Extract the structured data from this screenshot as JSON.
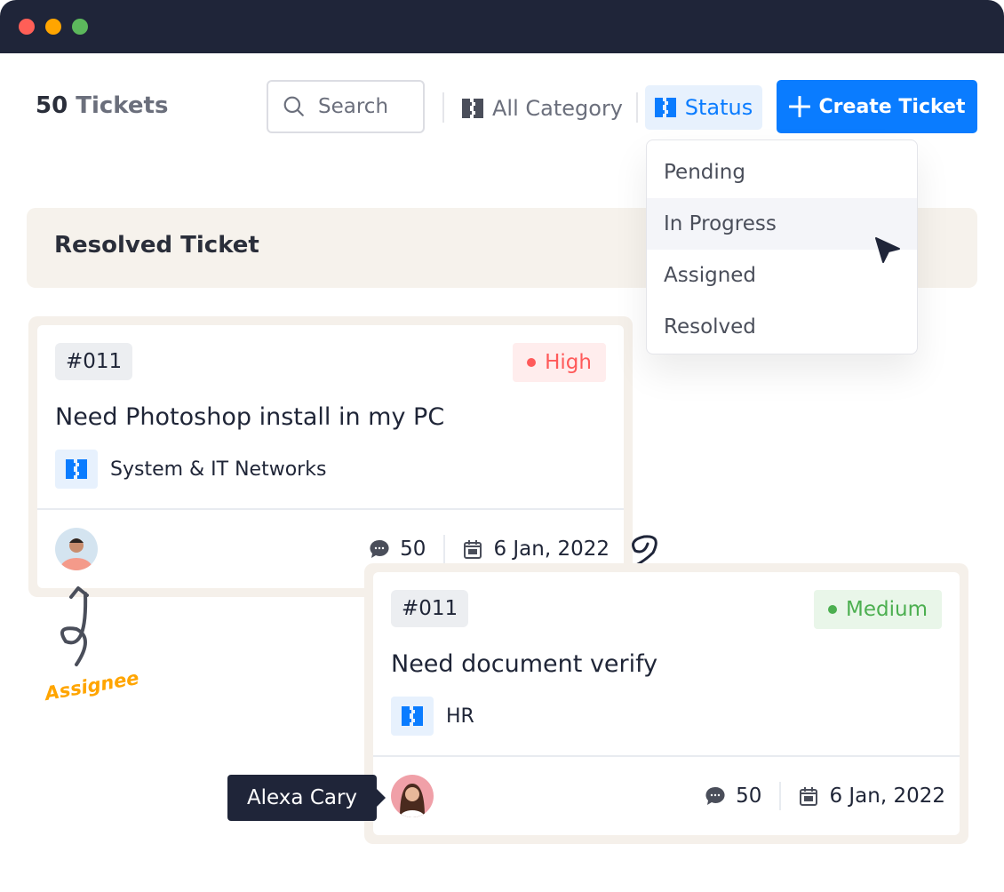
{
  "window": {
    "dots": [
      "#ff5f57",
      "#ffa500",
      "#5cb85c"
    ]
  },
  "header": {
    "count": "50",
    "count_label": "Tickets",
    "search_placeholder": "Search",
    "category_filter": "All Category",
    "status_filter": "Status",
    "create_button": "Create Ticket"
  },
  "status_dropdown": {
    "options": [
      "Pending",
      "In Progress",
      "Assigned",
      "Resolved"
    ],
    "highlighted": "In Progress"
  },
  "section_title": "Resolved Ticket",
  "tickets": [
    {
      "id": "#011",
      "priority": "High",
      "priority_color": "#ff5a5a",
      "priority_bg": "#ffeded",
      "title": "Need Photoshop install in my PC",
      "category": "System & IT Networks",
      "comments": "50",
      "date": "6 Jan, 2022"
    },
    {
      "id": "#011",
      "priority": "Medium",
      "priority_color": "#4caf50",
      "priority_bg": "#e9f6e9",
      "title": "Need document verify",
      "category": "HR",
      "comments": "50",
      "date": "6 Jan, 2022"
    }
  ],
  "annotations": {
    "assignee": "Assignee",
    "tooltip": "Alexa Cary"
  },
  "colors": {
    "accent": "#0a7cff",
    "dark": "#1f2539"
  }
}
